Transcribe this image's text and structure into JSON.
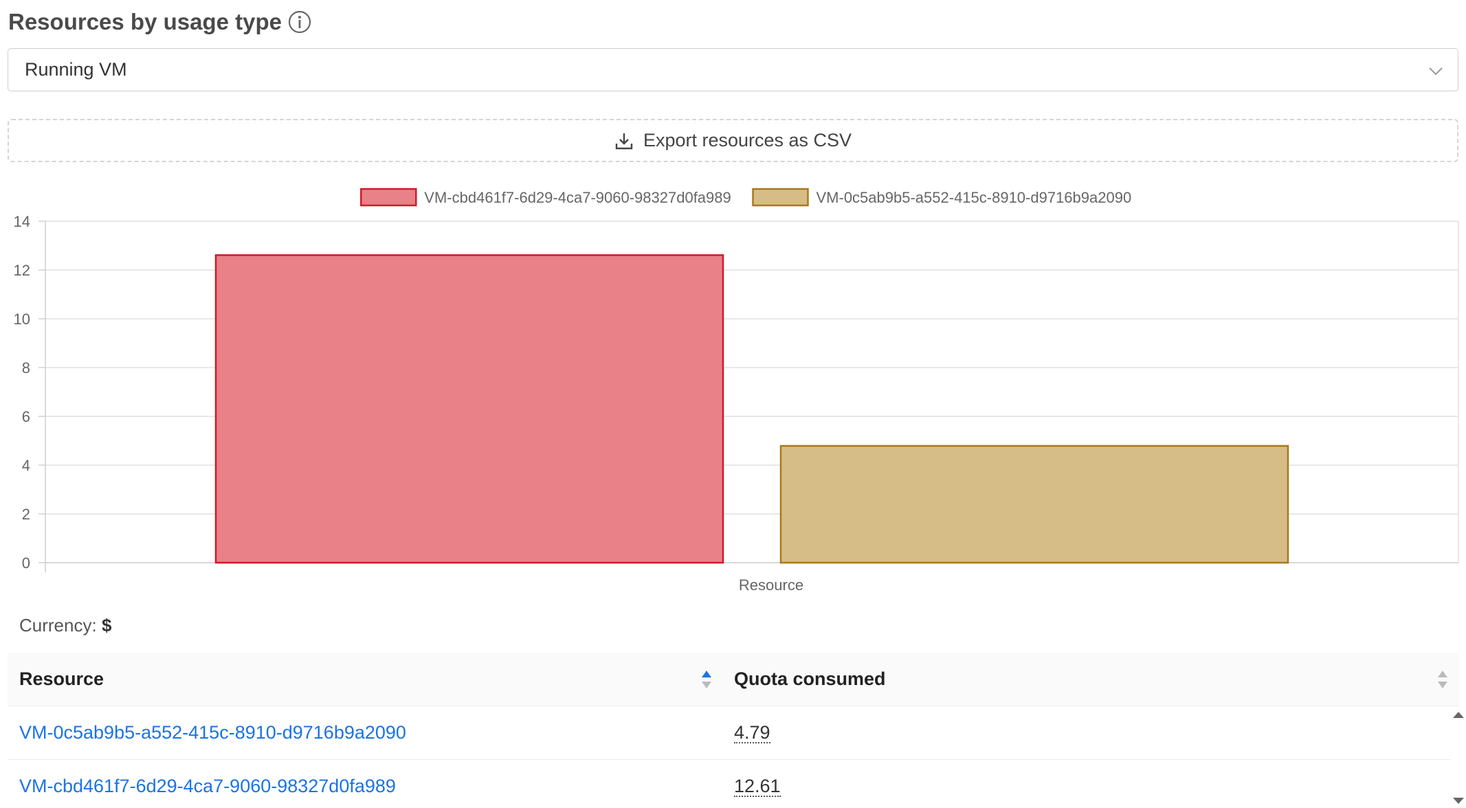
{
  "section": {
    "title": "Resources by usage type",
    "info_icon": "info-circle-icon"
  },
  "usage_select": {
    "value": "Running VM",
    "icon": "chevron-down-icon"
  },
  "export": {
    "label": "Export resources as CSV",
    "icon": "download-icon"
  },
  "colors": {
    "series1_fill": "#e98188",
    "series1_border": "#d0192a",
    "series2_fill": "#d6bc86",
    "series2_border": "#a8781c",
    "link": "#1a73e8"
  },
  "chart_data": {
    "type": "bar",
    "categories": [
      ""
    ],
    "series": [
      {
        "name": "VM-cbd461f7-6d29-4ca7-9060-98327d0fa989",
        "values": [
          12.61
        ]
      },
      {
        "name": "VM-0c5ab9b5-a552-415c-8910-d9716b9a2090",
        "values": [
          4.79
        ]
      }
    ],
    "xlabel": "Resource",
    "ylabel": "",
    "ylim": [
      0,
      14
    ],
    "yticks": [
      "0",
      "2",
      "4",
      "6",
      "8",
      "10",
      "12",
      "14"
    ],
    "grid": true,
    "legend": "top-center"
  },
  "currency": {
    "label": "Currency:",
    "symbol": "$"
  },
  "table": {
    "columns": [
      "Resource",
      "Quota consumed"
    ],
    "rows": [
      {
        "resource": "VM-0c5ab9b5-a552-415c-8910-d9716b9a2090",
        "quota": "4.79"
      },
      {
        "resource": "VM-cbd461f7-6d29-4ca7-9060-98327d0fa989",
        "quota": "12.61"
      }
    ]
  }
}
